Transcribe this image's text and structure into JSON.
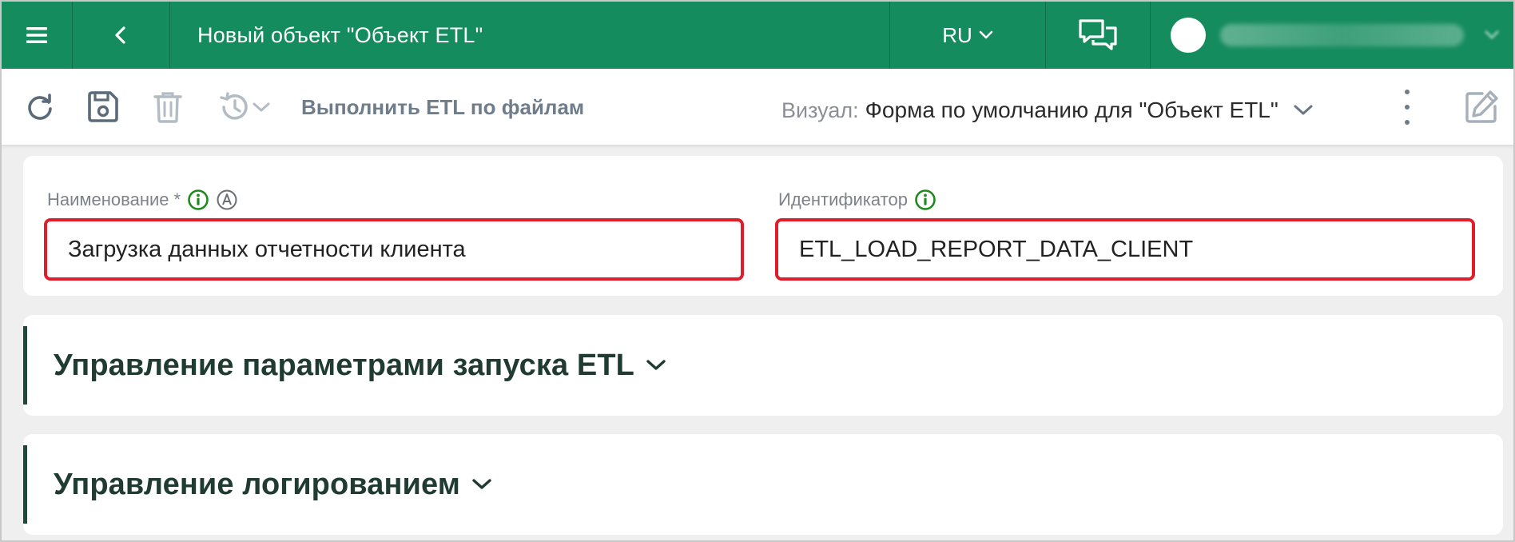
{
  "header": {
    "menu_icon": "hamburger-icon",
    "back_icon": "chevron-left-icon",
    "title": "Новый объект \"Объект ETL\"",
    "language": "RU",
    "chat_icon": "chat-bubbles-icon",
    "avatar_icon": "avatar",
    "colors": {
      "background": "#158c5e",
      "text": "#ffffff"
    }
  },
  "toolbar": {
    "refresh_icon": "refresh-icon",
    "save_icon": "save-icon",
    "delete_icon": "trash-icon",
    "history_icon": "history-icon",
    "run_label": "Выполнить ETL по файлам",
    "visual_label": "Визуал:",
    "visual_value": "Форма по умолчанию для \"Объект ETL\"",
    "more_icon": "kebab-icon",
    "edit_icon": "edit-icon"
  },
  "form": {
    "name_label": "Наименование",
    "name_required_mark": "*",
    "name_value": "Загрузка данных отчетности клиента",
    "id_label": "Идентификатор",
    "id_value": "ETL_LOAD_REPORT_DATA_CLIENT",
    "highlight_color": "#e01e2b"
  },
  "sections": [
    {
      "title": "Управление параметрами запуска ETL"
    },
    {
      "title": "Управление логированием"
    }
  ]
}
